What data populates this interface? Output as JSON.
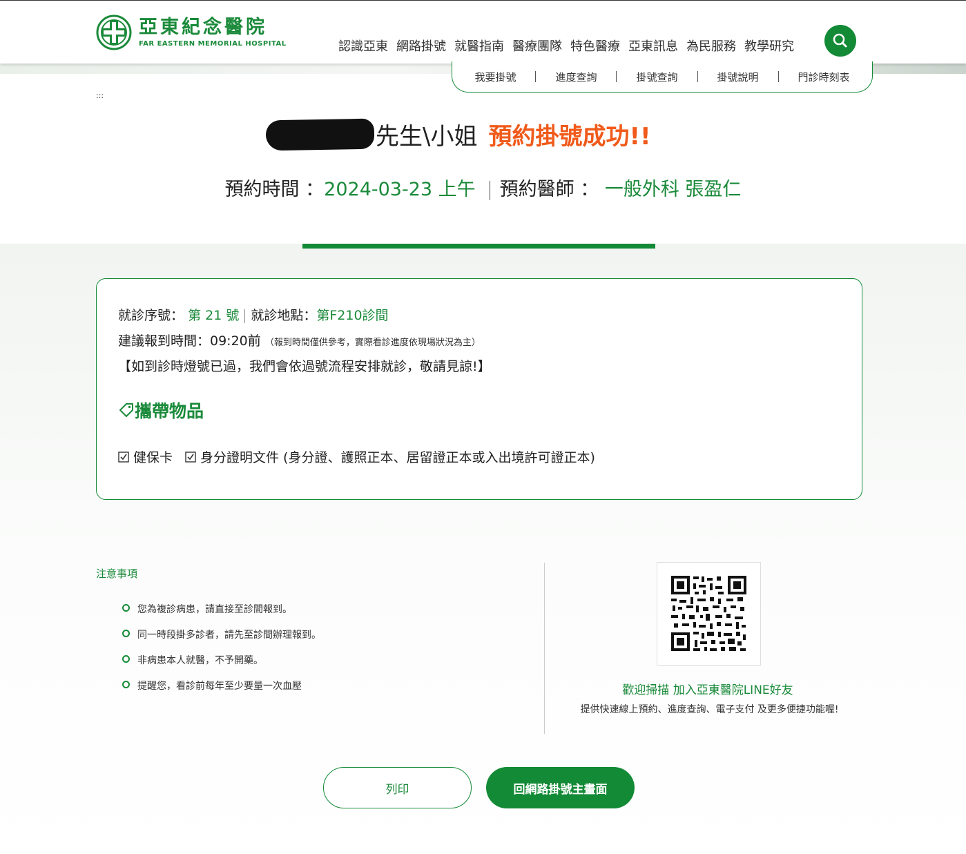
{
  "header": {
    "logo_cn": "亞東紀念醫院",
    "logo_en": "FAR EASTERN MEMORIAL HOSPITAL",
    "nav": [
      "認識亞東",
      "網路掛號",
      "就醫指南",
      "醫療團隊",
      "特色醫療",
      "亞東訊息",
      "為民服務",
      "教學研究"
    ],
    "search_icon": "search-icon"
  },
  "subnav": [
    "我要掛號",
    "進度查詢",
    "掛號查詢",
    "掛號說明",
    "門診時刻表"
  ],
  "skip_link": ":::",
  "result": {
    "salutation": "先生\\小姐",
    "success": "預約掛號成功!!",
    "time_label": "預約時間 ：",
    "time_value": "2024-03-23 上午",
    "doctor_label": "預約醫師 ：",
    "doctor_value": "一般外科 張盈仁"
  },
  "card": {
    "seq_label": "就診序號：",
    "seq_value": "第 21 號",
    "loc_label": "就診地點：",
    "loc_value": "第F210診間",
    "report_label": "建議報到時間：09:20前",
    "report_note": "（報到時間僅供參考，實際看診進度依現場狀況為主）",
    "notice": "【如到診時燈號已過，我們會依過號流程安排就診，敬請見諒!】",
    "items_title": "攜帶物品",
    "items": [
      "健保卡",
      "身分證明文件 (身分證、護照正本、居留證正本或入出境許可證正本)"
    ]
  },
  "notes": {
    "title": "注意事項",
    "items": [
      "您為複診病患，請直接至診間報到。",
      "同一時段掛多診者，請先至診間辦理報到。",
      "非病患本人就醫，不予開藥。",
      "提醒您，看診前每年至少要量一次血壓"
    ]
  },
  "line": {
    "caption": "歡迎掃描 加入亞東醫院LINE好友",
    "sub": "提供快速線上預約、進度查詢、電子支付 及更多便捷功能喔!"
  },
  "buttons": {
    "print": "列印",
    "home": "回網路掛號主畫面"
  },
  "colors": {
    "brand_green": "#138a36",
    "success_orange": "#f05a1a"
  }
}
